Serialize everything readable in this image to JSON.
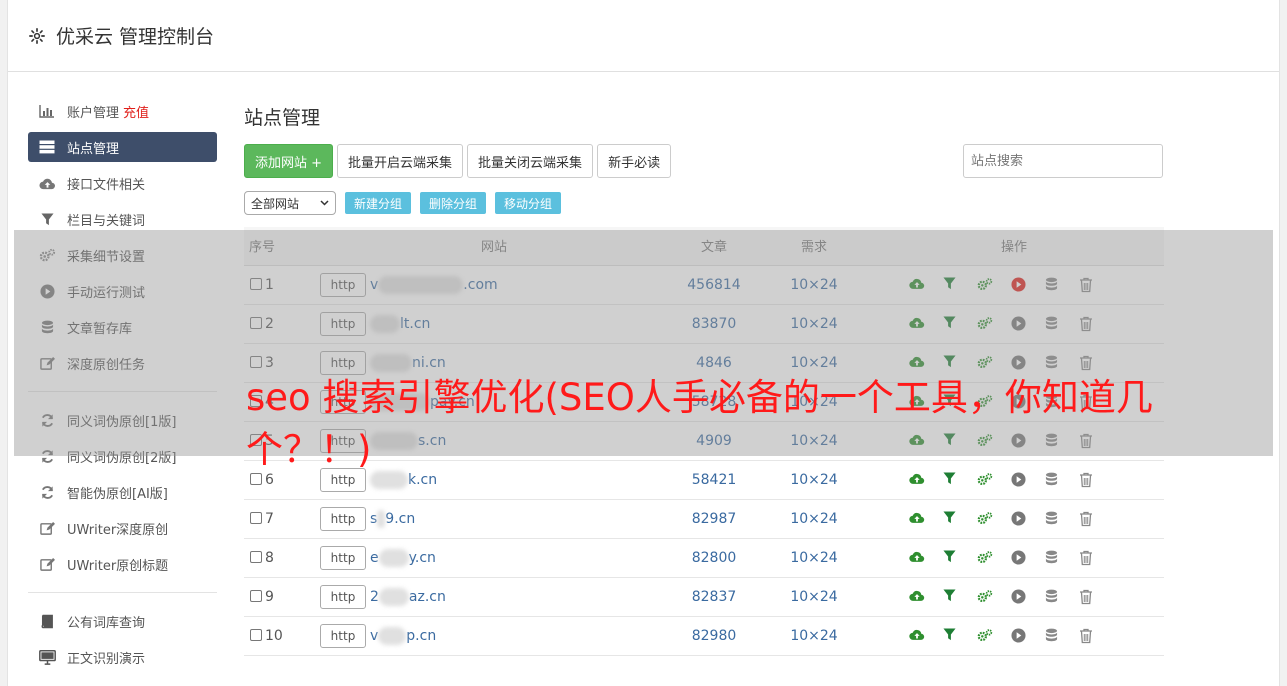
{
  "header": {
    "title": "优采云 管理控制台"
  },
  "sidebar": {
    "items": [
      {
        "label": "账户管理",
        "extra": "充值",
        "icon": "bar-chart-icon",
        "active": false
      },
      {
        "label": "站点管理",
        "icon": "server-icon",
        "active": true
      },
      {
        "label": "接口文件相关",
        "icon": "cloud-upload-icon",
        "active": false
      },
      {
        "label": "栏目与关键词",
        "icon": "filter-icon",
        "active": false
      },
      {
        "label": "采集细节设置",
        "icon": "gears-icon",
        "active": false
      },
      {
        "label": "手动运行测试",
        "icon": "play-icon",
        "active": false
      },
      {
        "label": "文章暂存库",
        "icon": "database-icon",
        "active": false
      },
      {
        "label": "深度原创任务",
        "icon": "edit-icon",
        "active": false
      }
    ],
    "items2": [
      {
        "label": "同义词伪原创[1版]",
        "icon": "refresh-icon"
      },
      {
        "label": "同义词伪原创[2版]",
        "icon": "refresh-icon"
      },
      {
        "label": "智能伪原创[AI版]",
        "icon": "refresh-icon"
      },
      {
        "label": "UWriter深度原创",
        "icon": "edit-icon"
      },
      {
        "label": "UWriter原创标题",
        "icon": "edit-icon"
      }
    ],
    "items3": [
      {
        "label": "公有词库查询",
        "icon": "book-icon"
      },
      {
        "label": "正文识别演示",
        "icon": "monitor-icon"
      }
    ]
  },
  "main": {
    "title": "站点管理",
    "toolbar": {
      "add": "添加网站 +",
      "batch_open": "批量开启云端采集",
      "batch_close": "批量关闭云端采集",
      "newbie": "新手必读",
      "search_placeholder": "站点搜索"
    },
    "group": {
      "select_value": "全部网站",
      "new_group": "新建分组",
      "delete_group": "删除分组",
      "move_group": "移动分组"
    },
    "table": {
      "headers": [
        "序号",
        "网站",
        "文章",
        "需求",
        "操作"
      ],
      "rows": [
        {
          "no": "1",
          "proto": "http",
          "pre": "v",
          "post": ".com",
          "articles": "456814",
          "req": "10×24"
        },
        {
          "no": "2",
          "proto": "http",
          "pre": "",
          "post": "lt.cn",
          "articles": "83870",
          "req": "10×24"
        },
        {
          "no": "3",
          "proto": "http",
          "pre": "",
          "post": "ni.cn",
          "articles": "4846",
          "req": "10×24"
        },
        {
          "no": "4",
          "proto": "http",
          "pre": "",
          "post": "pay.cn",
          "articles": "58728",
          "req": "10×24"
        },
        {
          "no": "5",
          "proto": "http",
          "pre": "",
          "post": "s.cn",
          "articles": "4909",
          "req": "10×24"
        },
        {
          "no": "6",
          "proto": "http",
          "pre": "",
          "post": "k.cn",
          "articles": "58421",
          "req": "10×24"
        },
        {
          "no": "7",
          "proto": "http",
          "pre": "s",
          "post": "9.cn",
          "articles": "82987",
          "req": "10×24"
        },
        {
          "no": "8",
          "proto": "http",
          "pre": "e",
          "post": "y.cn",
          "articles": "82800",
          "req": "10×24"
        },
        {
          "no": "9",
          "proto": "http",
          "pre": "2",
          "post": "az.cn",
          "articles": "82837",
          "req": "10×24"
        },
        {
          "no": "10",
          "proto": "http",
          "pre": "v",
          "post": "p.cn",
          "articles": "82980",
          "req": "10×24"
        }
      ]
    }
  },
  "overlay": {
    "headline": "seo 搜索引擎优化(SEO人手必备的一个工具，你知道几个？！)"
  },
  "colors": {
    "sidebar_active": "#3e4e6a",
    "green": "#5cb85c",
    "info": "#5bc0de",
    "headline": "#ff1a1a",
    "link": "#3a6aa0"
  }
}
